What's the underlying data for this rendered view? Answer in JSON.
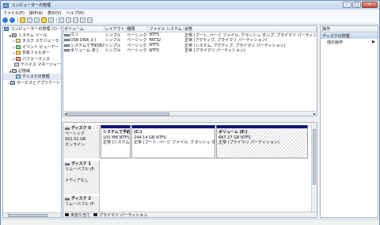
{
  "window": {
    "title": "コンピューターの管理",
    "min": "–",
    "max": "□",
    "close": "✕"
  },
  "menu": [
    "ファイル(F)",
    "操作(A)",
    "表示(V)",
    "ヘルプ(H)"
  ],
  "tree": [
    {
      "label": "コンピューターの管理 (ロー",
      "exp": "",
      "icon": "i-comp",
      "indent": 0
    },
    {
      "label": "システム ツール",
      "exp": "◢",
      "icon": "i-tool",
      "indent": 1
    },
    {
      "label": "タスク スケジューラ",
      "exp": "▷",
      "icon": "i-task",
      "indent": 2
    },
    {
      "label": "イベント ビューアー",
      "exp": "▷",
      "icon": "i-ev",
      "indent": 2
    },
    {
      "label": "共有フォルダー",
      "exp": "▷",
      "icon": "i-fold",
      "indent": 2
    },
    {
      "label": "パフォーマンス",
      "exp": "▷",
      "icon": "i-perf",
      "indent": 2
    },
    {
      "label": "デバイス マネージャー",
      "exp": "",
      "icon": "i-dev",
      "indent": 2
    },
    {
      "label": "記憶域",
      "exp": "◢",
      "icon": "i-stor",
      "indent": 1
    },
    {
      "label": "ディスクの管理",
      "exp": "",
      "icon": "i-disk",
      "indent": 2,
      "selected": true
    },
    {
      "label": "サービスとアプリケーション",
      "exp": "▷",
      "icon": "i-svc",
      "indent": 1
    }
  ],
  "volume_table": {
    "headers": [
      "ボリューム",
      "レイアウト",
      "種類",
      "ファイル システム",
      "状態"
    ],
    "rows": [
      [
        "(C:)",
        "シンプル",
        "ベーシック",
        "NTFS",
        "正常 (ブート, ページ ファイル, クラッシュ ダンプ, プライマリ パーティション"
      ],
      [
        "USB DISK (I:)",
        "シンプル",
        "ベーシック",
        "FAT32",
        "正常 (アクティブ, プライマリ パーティション)"
      ],
      [
        "システムで予約済み",
        "シンプル",
        "ベーシック",
        "NTFS",
        "正常 (システム, アクティブ, プライマリ パーティション)"
      ],
      [
        "ボリューム (E:)",
        "シンプル",
        "ベーシック",
        "NTFS",
        "正常 (プライマリ パーティション)"
      ]
    ]
  },
  "disks": [
    {
      "name": "ディスク 0",
      "lines": [
        "ベーシック",
        "931.51 GB",
        "オンライン"
      ],
      "partitions": [
        {
          "name": "システムで予約",
          "size": "100 MB NTFS",
          "status": "正常 (システム,",
          "style": "solid"
        },
        {
          "name": "(C:)",
          "size": "244.14 GB NTFS",
          "status": "正常 (ブート, ページ ファイル, クラッシュ ダン",
          "style": "solid"
        },
        {
          "name": "ボリューム (E:)",
          "size": "687.27 GB NTFS",
          "status": "正常 (プライマリ パーティション)",
          "style": "hatch"
        }
      ]
    },
    {
      "name": "ディスク 1",
      "lines": [
        "リムーバブル (F:",
        "",
        "メディアなし"
      ],
      "partitions": []
    },
    {
      "name": "ディスク 2",
      "lines": [
        "リムーバブル (F:",
        ""
      ],
      "partitions": []
    }
  ],
  "legend": [
    "未割り当て",
    "プライマリ パーティション"
  ],
  "actions": {
    "header": "操作",
    "section": "ディスクの管理",
    "items": [
      "他の操作"
    ]
  }
}
